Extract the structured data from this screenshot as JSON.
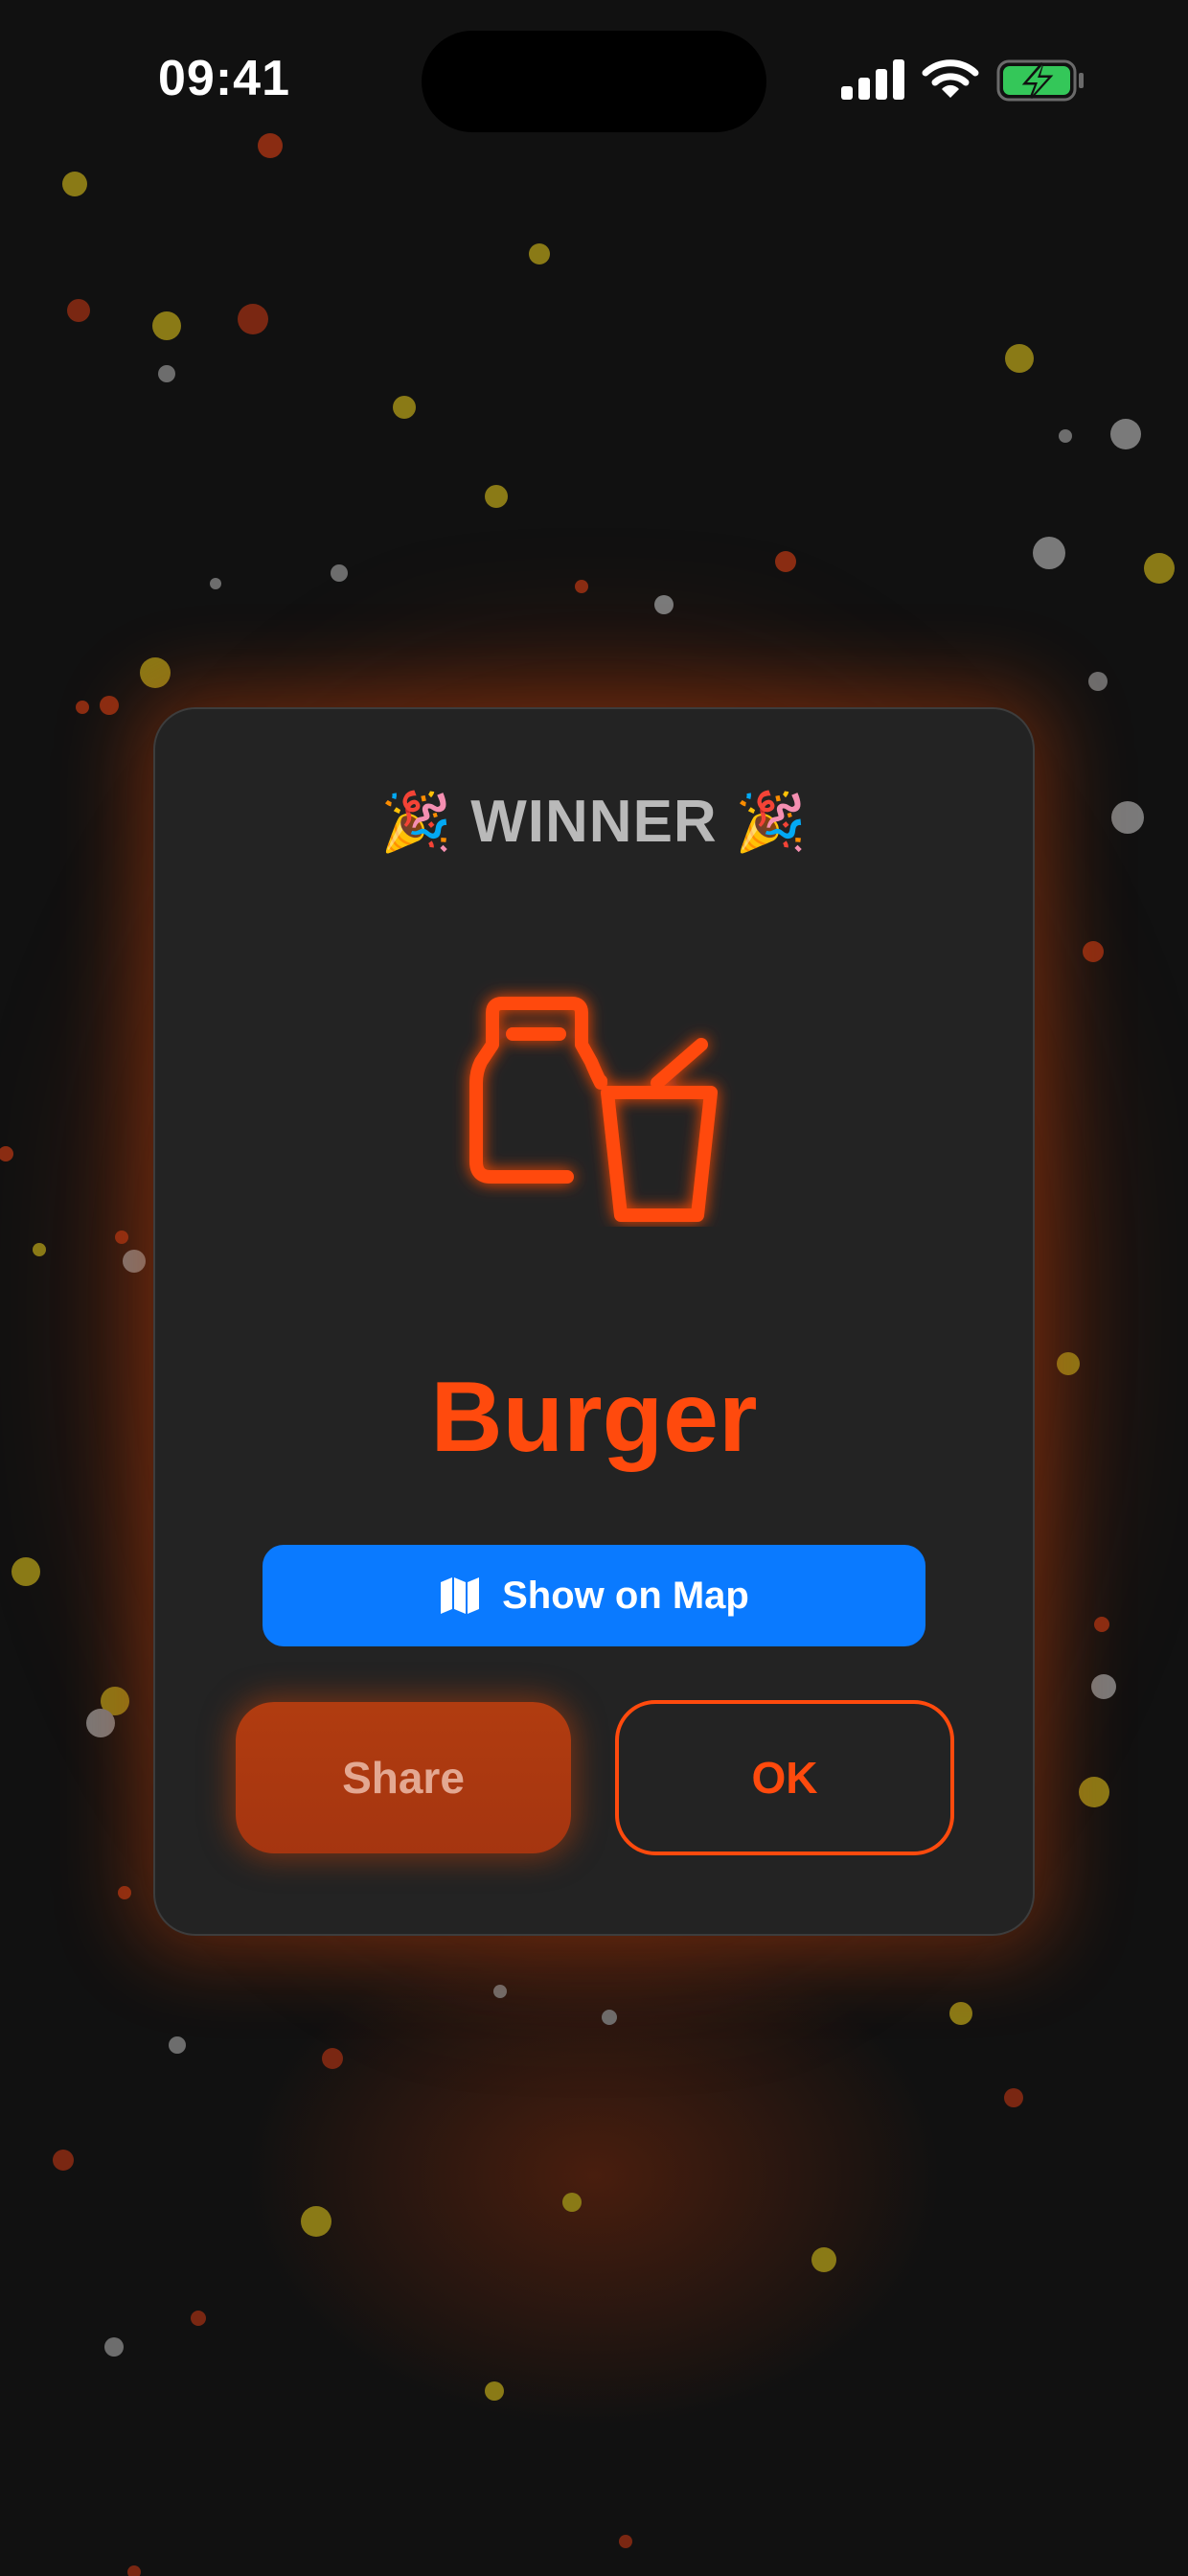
{
  "status_bar": {
    "time": "09:41",
    "icons": [
      "signal-icon",
      "wifi-icon",
      "battery-charging-icon"
    ]
  },
  "card": {
    "heading": "WINNER",
    "heading_emoji_left": "🎉",
    "heading_emoji_right": "🎉",
    "icon": "fast-food-icon",
    "result": "Burger",
    "map_button_icon": "map-icon",
    "map_button_label": "Show on Map",
    "share_label": "Share",
    "ok_label": "OK"
  },
  "colors": {
    "accent": "#ff4a0d",
    "map_blue": "#0a7aff",
    "card_bg": "#232323",
    "background": "#111111",
    "battery_green": "#34c759"
  }
}
